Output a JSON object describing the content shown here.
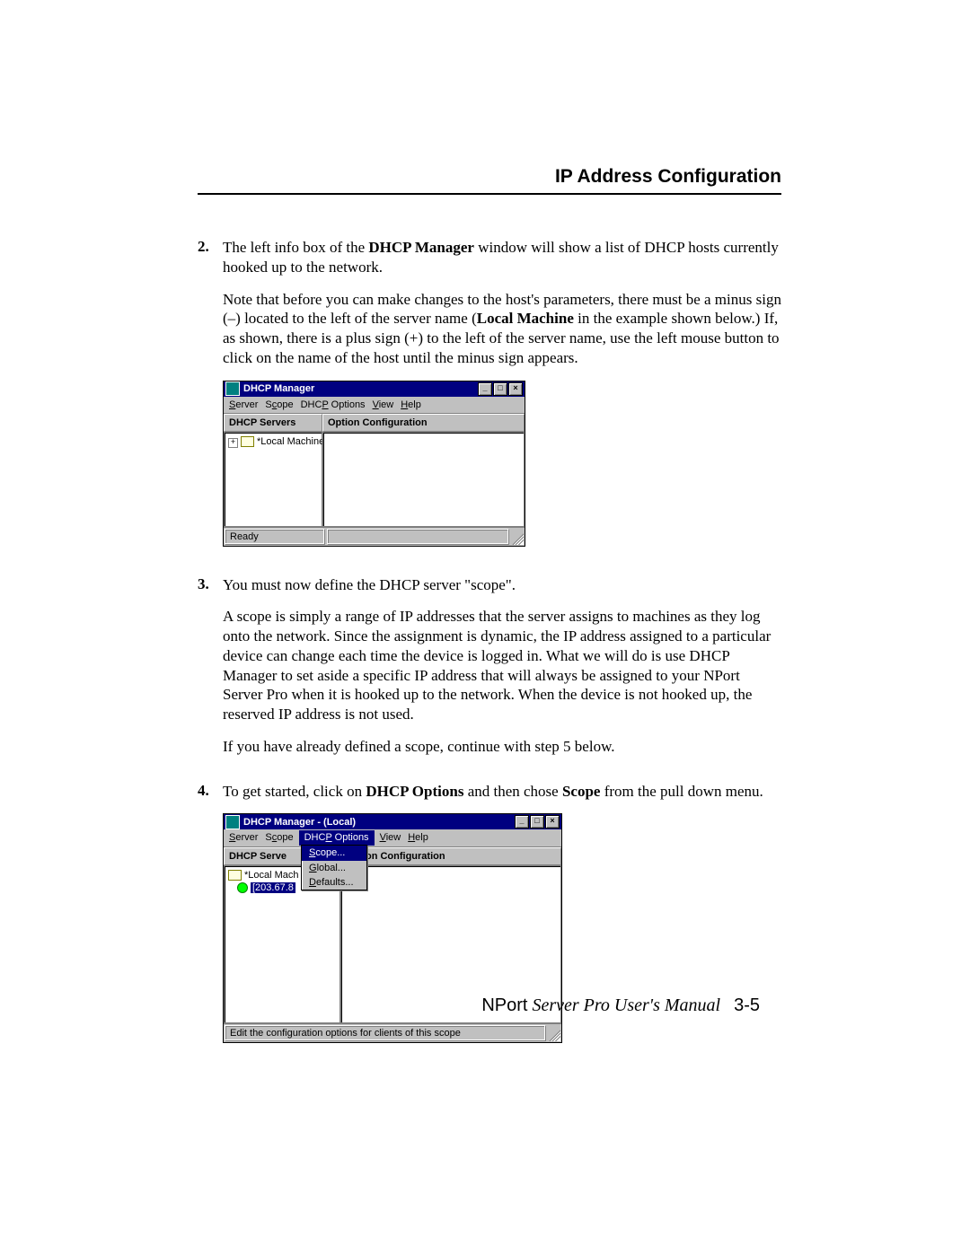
{
  "header": {
    "title": "IP Address Configuration"
  },
  "steps": {
    "s2": {
      "num": "2.",
      "p1a": "The left info box of the ",
      "p1b": "DHCP Manager",
      "p1c": " window will show a list of DHCP hosts currently hooked up to the network.",
      "p2a": "Note that before you can make changes to the host's parameters, there must be a minus sign (–) located to the left of the server name (",
      "p2b": "Local Machine",
      "p2c": " in the example shown below.) If, as shown, there is a plus sign (+) to the left of the server name, use the left mouse button to click on the name of the host until the minus sign appears."
    },
    "s3": {
      "num": "3.",
      "p1": "You must now define the DHCP server \"scope\".",
      "p2": "A scope is simply a range of IP addresses that the server assigns to machines as they log onto the network. Since the assignment is dynamic, the IP address assigned to a particular device can change each time the device is logged in. What we will do is use DHCP Manager to set aside a specific IP address that will always be assigned to your NPort Server Pro when it is hooked up to the network. When the device is not hooked up, the reserved IP address is not used.",
      "p3": "If you have already defined a scope, continue with step 5 below."
    },
    "s4": {
      "num": "4.",
      "p1a": "To get started, click on ",
      "p1b": "DHCP Options",
      "p1c": " and then chose ",
      "p1d": "Scope",
      "p1e": " from the pull down menu."
    }
  },
  "fig1": {
    "title": "DHCP Manager",
    "menu": {
      "server": "Server",
      "scope": "Scope",
      "dhcp": "DHCP Options",
      "view": "View",
      "help": "Help"
    },
    "left_head": "DHCP Servers",
    "right_head": "Option Configuration",
    "tree_plus": "+",
    "tree_label": "*Local Machine*",
    "status": "Ready",
    "btn_min": "_",
    "btn_max": "□",
    "btn_close": "×"
  },
  "fig2": {
    "title": "DHCP Manager - (Local)",
    "menu": {
      "server": "Server",
      "scope": "Scope",
      "dhcp": "DHCP Options",
      "view": "View",
      "help": "Help"
    },
    "left_head": "DHCP Serve",
    "right_head": "Option Configuration",
    "tree_root": "*Local Mach",
    "tree_ip": "[203.67.8",
    "popup": {
      "scope": "Scope...",
      "global": "Global...",
      "defaults": "Defaults..."
    },
    "status": "Edit the configuration options for clients of this scope",
    "btn_min": "_",
    "btn_max": "□",
    "btn_close": "×"
  },
  "footer": {
    "product": "NPort",
    "manual": "Server Pro User's Manual",
    "page": "3-5"
  }
}
